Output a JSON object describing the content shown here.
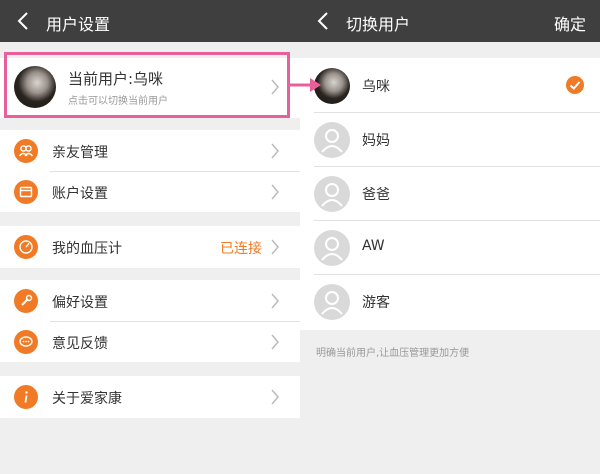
{
  "left": {
    "title": "用户设置",
    "current_user": {
      "title": "当前用户:乌咪",
      "subtitle": "点击可以切换当前用户"
    },
    "menu": [
      {
        "label": "亲友管理",
        "icon": "people-icon"
      },
      {
        "label": "账户设置",
        "icon": "card-icon"
      },
      {
        "label": "我的血压计",
        "icon": "meter-icon",
        "status": "已连接"
      },
      {
        "label": "偏好设置",
        "icon": "wrench-icon"
      },
      {
        "label": "意见反馈",
        "icon": "chat-icon"
      },
      {
        "label": "关于爱家康",
        "icon": "info-icon"
      }
    ]
  },
  "right": {
    "title": "切换用户",
    "confirm": "确定",
    "users": [
      {
        "name": "乌咪",
        "selected": true
      },
      {
        "name": "妈妈",
        "selected": false
      },
      {
        "name": "爸爸",
        "selected": false
      },
      {
        "name": "AW",
        "selected": false
      },
      {
        "name": "游客",
        "selected": false
      }
    ],
    "hint": "明确当前用户,让血压管理更加方便"
  },
  "colors": {
    "accent": "#f07a25",
    "navbar": "#3f3f3f",
    "highlight": "#e8609a",
    "background": "#efefef"
  }
}
